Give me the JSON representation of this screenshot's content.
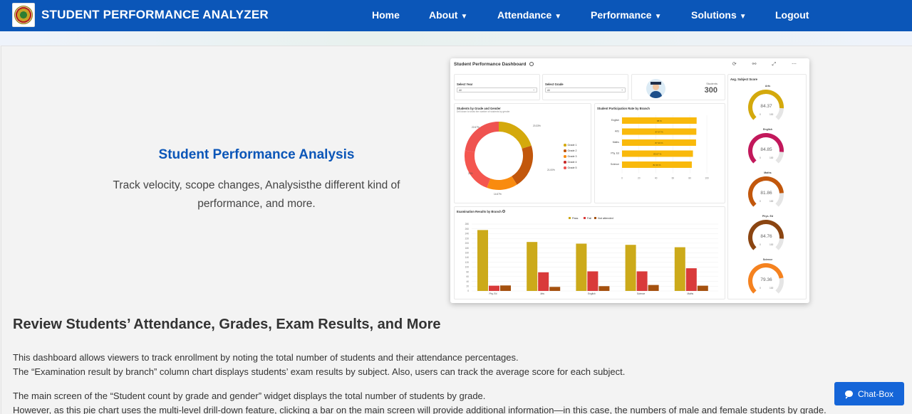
{
  "header": {
    "brand": "STUDENT PERFORMANCE ANALYZER",
    "nav": [
      {
        "label": "Home",
        "dropdown": false
      },
      {
        "label": "About",
        "dropdown": true
      },
      {
        "label": "Attendance",
        "dropdown": true
      },
      {
        "label": "Performance",
        "dropdown": true
      },
      {
        "label": "Solutions",
        "dropdown": true
      },
      {
        "label": "Logout",
        "dropdown": false
      }
    ],
    "caret": "▼"
  },
  "hero": {
    "title": "Student Performance Analysis",
    "text": "Track velocity, scope changes, Analysisthe different kind of performance, and more."
  },
  "dashboard": {
    "title": "Student Performance Dashboard",
    "tools": "⟳ ⚯ ⤢ ⋯",
    "select_year": {
      "label": "Select Year",
      "value": "All"
    },
    "select_grade": {
      "label": "Select Grade",
      "value": "All"
    },
    "students": {
      "label": "Students",
      "value": "300"
    },
    "donut": {
      "title": "Students by Grade and Gender",
      "subtitle": "Drill down to show the number of students by gender",
      "labels": [
        "20.33%",
        "21.00%",
        "14.67%",
        "22%",
        "22.67%"
      ],
      "legend": [
        "Grade 1",
        "Grade 2",
        "Grade 3",
        "Grade 4",
        "Grade 5"
      ]
    },
    "participation": {
      "title": "Student Participation Rate by Branch",
      "branches": [
        "English",
        "Arts",
        "Maths",
        "Phy. Ed",
        "Science"
      ],
      "values": [
        88,
        87.67,
        87.33,
        83.67,
        82.33
      ],
      "value_labels": [
        "88 %",
        "87.67 %",
        "87.33 %",
        "83.67 %",
        "82.33 %"
      ],
      "ticks": [
        "0",
        "20",
        "40",
        "60",
        "80",
        "100"
      ]
    },
    "exam": {
      "title": "Examination Results by Branch",
      "legend": [
        "Pass",
        "Fail",
        "Not attended"
      ],
      "categories": [
        "Phy. Ed",
        "Arts",
        "English",
        "Science",
        "Maths"
      ],
      "pass": [
        255,
        205,
        198,
        193,
        183
      ],
      "fail": [
        22,
        78,
        82,
        82,
        95
      ],
      "not_attended": [
        23,
        17,
        20,
        25,
        22
      ],
      "ymax": 280,
      "ticks": [
        "280",
        "260",
        "240",
        "220",
        "200",
        "180",
        "160",
        "140",
        "120",
        "100",
        "80",
        "60",
        "40",
        "20",
        "0"
      ]
    },
    "gauges": {
      "title": "Avg. Subject Score",
      "items": [
        {
          "name": "Arts",
          "value": 84.37,
          "label": "84.37",
          "color": "#d4a90c"
        },
        {
          "name": "English",
          "value": 84.85,
          "label": "84.85",
          "color": "#c2185b"
        },
        {
          "name": "Maths",
          "value": 81.86,
          "label": "81.86",
          "color": "#c2570c"
        },
        {
          "name": "Phys. Ed",
          "value": 84.76,
          "label": "84.76",
          "color": "#8b4511"
        },
        {
          "name": "Science",
          "value": 79.36,
          "label": "79.36",
          "color": "#f5821f"
        }
      ],
      "min_label": "0",
      "max_label": "100"
    },
    "colors": {
      "grade1": "#d4a90c",
      "grade2": "#c2570c",
      "grade3": "#f98b0f",
      "grade4": "#c62828",
      "grade5": "#ef5350",
      "bar": "#f9b90b",
      "pass": "#ccaa1a",
      "fail": "#d93a3a",
      "not_attended": "#a5510f"
    }
  },
  "main": {
    "section_title": "Review Students’ Attendance, Grades, Exam Results, and More",
    "paragraphs": [
      "This dashboard allows viewers to track enrollment by noting the total number of students and their attendance percentages.",
      "The “Examination result by branch” column chart displays students’ exam results by subject. Also, users can track the average score for each subject.",
      "The main screen of the “Student count by grade and gender” widget displays the total number of students by grade.",
      "However, as this pie chart uses the multi-level drill-down feature, clicking a bar on the main screen will provide additional information—in this case, the numbers of male and female students by grade."
    ]
  },
  "chat": {
    "label": "Chat-Box"
  }
}
